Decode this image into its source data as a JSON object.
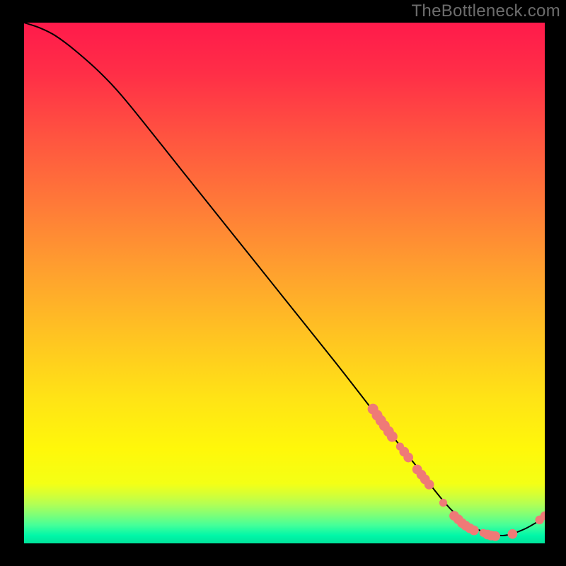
{
  "watermark": "TheBottleneck.com",
  "colors": {
    "frame": "#000000",
    "watermark": "#6d6d6d",
    "curve": "#000000",
    "point_fill": "#ef7a77",
    "point_stroke": "#ef7a77",
    "gradient_stops": [
      {
        "offset": 0.0,
        "color": "#ff1a4b"
      },
      {
        "offset": 0.1,
        "color": "#ff2f47"
      },
      {
        "offset": 0.22,
        "color": "#ff5440"
      },
      {
        "offset": 0.35,
        "color": "#ff7a38"
      },
      {
        "offset": 0.48,
        "color": "#ffa12e"
      },
      {
        "offset": 0.6,
        "color": "#ffc322"
      },
      {
        "offset": 0.72,
        "color": "#ffe316"
      },
      {
        "offset": 0.82,
        "color": "#fff80a"
      },
      {
        "offset": 0.885,
        "color": "#f4ff15"
      },
      {
        "offset": 0.905,
        "color": "#d7ff33"
      },
      {
        "offset": 0.925,
        "color": "#b2ff55"
      },
      {
        "offset": 0.945,
        "color": "#7fff77"
      },
      {
        "offset": 0.965,
        "color": "#45ff99"
      },
      {
        "offset": 0.985,
        "color": "#00f7a8"
      },
      {
        "offset": 1.0,
        "color": "#00e39b"
      }
    ]
  },
  "chart_data": {
    "type": "line",
    "title": "",
    "xlabel": "",
    "ylabel": "",
    "xlim": [
      0,
      100
    ],
    "ylim": [
      0,
      100
    ],
    "grid": false,
    "legend": false,
    "series": [
      {
        "name": "bottleneck-curve",
        "x": [
          0,
          3,
          6,
          10,
          15,
          20,
          30,
          40,
          50,
          60,
          67,
          72,
          76,
          79,
          82,
          85,
          88,
          92,
          96,
          100
        ],
        "y": [
          100,
          99,
          97.5,
          94.5,
          90,
          84.5,
          72,
          59.5,
          47,
          34.5,
          25.5,
          19,
          14,
          10,
          6.5,
          4,
          2.3,
          1.5,
          2.7,
          5
        ]
      }
    ],
    "points": {
      "name": "highlighted-points",
      "style": "round-marker",
      "data": [
        {
          "x": 67.0,
          "y": 25.8,
          "r": 1.2
        },
        {
          "x": 67.8,
          "y": 24.6,
          "r": 1.2
        },
        {
          "x": 68.5,
          "y": 23.6,
          "r": 1.2
        },
        {
          "x": 69.2,
          "y": 22.6,
          "r": 1.2
        },
        {
          "x": 70.0,
          "y": 21.5,
          "r": 1.2
        },
        {
          "x": 70.7,
          "y": 20.5,
          "r": 1.2
        },
        {
          "x": 72.2,
          "y": 18.6,
          "r": 0.9
        },
        {
          "x": 73.0,
          "y": 17.6,
          "r": 1.1
        },
        {
          "x": 73.8,
          "y": 16.5,
          "r": 1.1
        },
        {
          "x": 75.5,
          "y": 14.2,
          "r": 1.1
        },
        {
          "x": 76.3,
          "y": 13.2,
          "r": 1.1
        },
        {
          "x": 77.0,
          "y": 12.3,
          "r": 1.1
        },
        {
          "x": 77.8,
          "y": 11.3,
          "r": 1.1
        },
        {
          "x": 80.5,
          "y": 7.8,
          "r": 0.9
        },
        {
          "x": 82.6,
          "y": 5.3,
          "r": 1.1
        },
        {
          "x": 83.4,
          "y": 4.6,
          "r": 1.1
        },
        {
          "x": 84.1,
          "y": 3.9,
          "r": 1.1
        },
        {
          "x": 84.8,
          "y": 3.4,
          "r": 1.1
        },
        {
          "x": 85.6,
          "y": 2.9,
          "r": 1.1
        },
        {
          "x": 86.4,
          "y": 2.5,
          "r": 1.1
        },
        {
          "x": 88.2,
          "y": 2.0,
          "r": 0.9
        },
        {
          "x": 89.0,
          "y": 1.7,
          "r": 1.1
        },
        {
          "x": 89.7,
          "y": 1.5,
          "r": 1.1
        },
        {
          "x": 90.5,
          "y": 1.4,
          "r": 1.1
        },
        {
          "x": 93.8,
          "y": 1.8,
          "r": 1.1
        },
        {
          "x": 99.0,
          "y": 4.5,
          "r": 1.0
        },
        {
          "x": 100.0,
          "y": 5.3,
          "r": 1.0
        }
      ]
    }
  }
}
